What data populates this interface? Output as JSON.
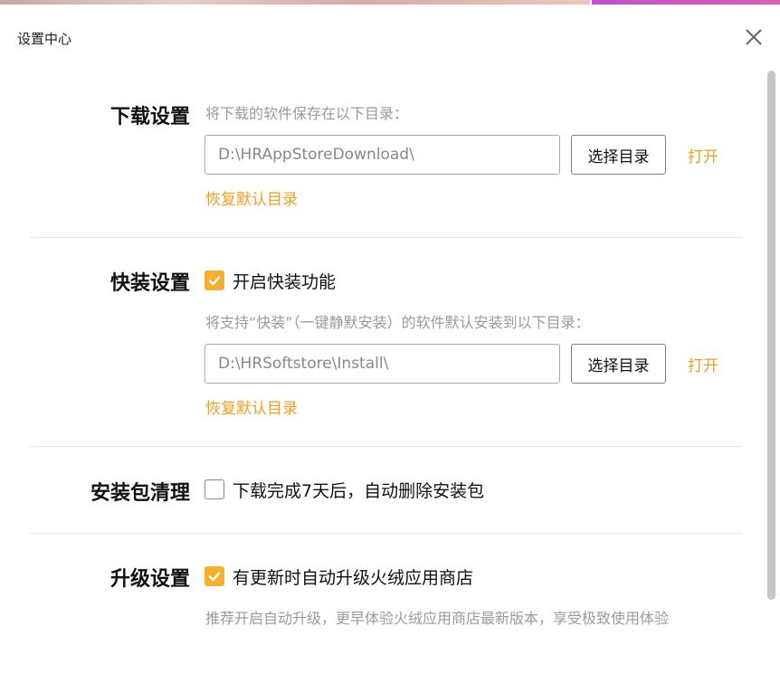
{
  "window": {
    "title": "设置中心"
  },
  "download": {
    "title": "下载设置",
    "hint": "将下载的软件保存在以下目录：",
    "path": "D:\\HRAppStoreDownload\\",
    "choose_label": "选择目录",
    "open_label": "打开",
    "restore_label": "恢复默认目录"
  },
  "quick_install": {
    "title": "快装设置",
    "checkbox_label": "开启快装功能",
    "checked": true,
    "hint": "将支持“快装”（一键静默安装）的软件默认安装到以下目录：",
    "path": "D:\\HRSoftstore\\Install\\",
    "choose_label": "选择目录",
    "open_label": "打开",
    "restore_label": "恢复默认目录"
  },
  "cleanup": {
    "title": "安装包清理",
    "checkbox_label": "下载完成7天后，自动删除安装包",
    "checked": false
  },
  "upgrade": {
    "title": "升级设置",
    "checkbox_label": "有更新时自动升级火绒应用商店",
    "checked": true,
    "hint": "推荐开启自动升级，更早体验火绒应用商店最新版本，享受极致使用体验"
  },
  "colors": {
    "accent": "#f6b12c",
    "link": "#f0a021"
  }
}
